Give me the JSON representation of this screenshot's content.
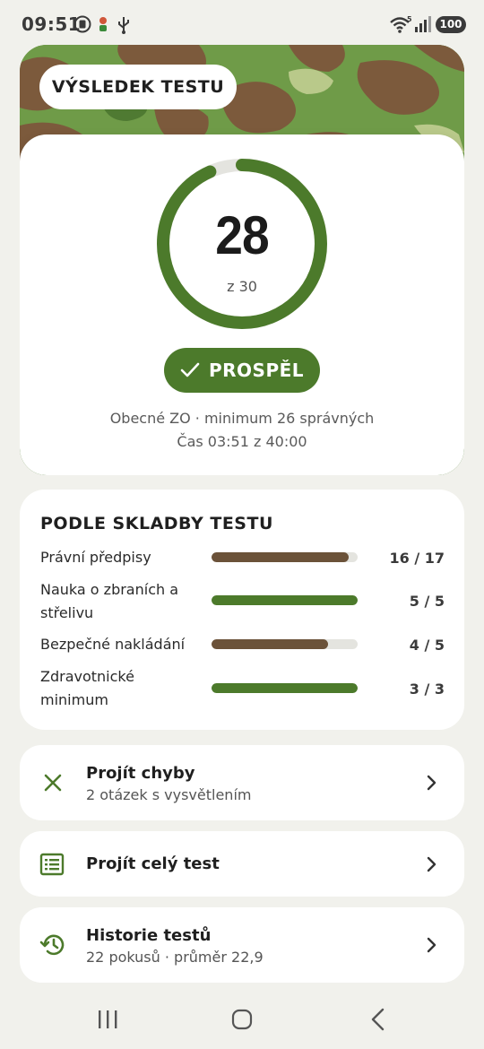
{
  "status_bar": {
    "time": "09:51",
    "battery": "100",
    "icons": [
      "notification-icon",
      "person-icon",
      "usb-icon",
      "wifi-icon",
      "signal-icon"
    ]
  },
  "header": {
    "title": "VÝSLEDEK TESTU"
  },
  "result": {
    "score": "28",
    "total_label": "z 30",
    "score_fraction": 0.9333,
    "status_label": "PROSPĚL",
    "status_icon": "check-icon",
    "info_line1": "Obecné ZO · minimum 26 správných",
    "info_line2": "Čas 03:51 z 40:00"
  },
  "breakdown": {
    "title": "PODLE SKLADBY TESTU",
    "rows": [
      {
        "label": "Právní předpisy",
        "score": "16 / 17",
        "fraction": 0.941,
        "color": "#6b5239"
      },
      {
        "label": "Nauka o zbraních a střelivu",
        "score": "5 / 5",
        "fraction": 1.0,
        "color": "#4c7a2b"
      },
      {
        "label": "Bezpečné nakládání",
        "score": "4 / 5",
        "fraction": 0.8,
        "color": "#6b5239"
      },
      {
        "label": "Zdravotnické minimum",
        "score": "3 / 3",
        "fraction": 1.0,
        "color": "#4c7a2b"
      }
    ]
  },
  "actions": [
    {
      "title": "Projít chyby",
      "subtitle": "2 otázek s vysvětlením",
      "icon": "close-icon"
    },
    {
      "title": "Projít celý test",
      "subtitle": "",
      "icon": "list-icon"
    },
    {
      "title": "Historie testů",
      "subtitle": "22 pokusů · průměr 22,9",
      "icon": "history-icon"
    }
  ],
  "colors": {
    "accent": "#4c7a2b",
    "brown": "#6b5239",
    "track": "#e4e4df",
    "background": "#f1f1ec"
  }
}
